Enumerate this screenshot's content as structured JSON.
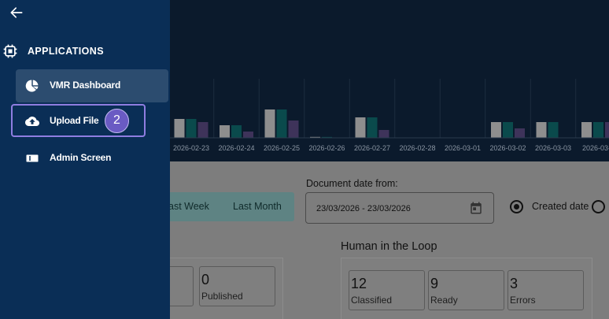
{
  "sidebar": {
    "section_title": "APPLICATIONS",
    "items": [
      {
        "label": "VMR Dashboard",
        "icon": "pie-chart-icon",
        "active": true
      },
      {
        "label": "Upload File",
        "icon": "cloud-upload-icon",
        "highlighted": true,
        "badge": "2"
      },
      {
        "label": "Admin Screen",
        "icon": "admin-screen-icon"
      }
    ]
  },
  "chart_data": {
    "type": "bar",
    "categories": [
      "2026-02-23",
      "2026-02-24",
      "2026-02-25",
      "2026-02-26",
      "2026-02-27",
      "2026-02-28",
      "2026-03-01",
      "2026-03-02",
      "2026-03-03",
      "2026-03-0"
    ],
    "series": [
      {
        "values": [
          6,
          4,
          9,
          0.3,
          6.5,
          0,
          0,
          5,
          5,
          5
        ]
      },
      {
        "values": [
          6,
          4,
          9,
          0.3,
          6.5,
          0,
          0,
          5,
          5,
          5
        ]
      },
      {
        "values": [
          5,
          2,
          5.5,
          0,
          2.5,
          0,
          0,
          3,
          0,
          5
        ]
      }
    ],
    "colors": [
      "#d9d9d9",
      "#0c6e6e",
      "#4b3d6b"
    ]
  },
  "filters": {
    "period_tabs": [
      "ast Week",
      "Last Month"
    ],
    "date_label": "Document date from:",
    "date_value": "23/03/2026 - 23/03/2026",
    "radio_label": "Created date"
  },
  "stats": {
    "left": [
      {
        "value": "",
        "label": ""
      },
      {
        "value": "0",
        "label": "Published"
      }
    ],
    "hitl_title": "Human in the Loop",
    "hitl": [
      {
        "value": "12",
        "label": "Classified"
      },
      {
        "value": "9",
        "label": "Ready"
      },
      {
        "value": "3",
        "label": "Errors"
      }
    ]
  }
}
